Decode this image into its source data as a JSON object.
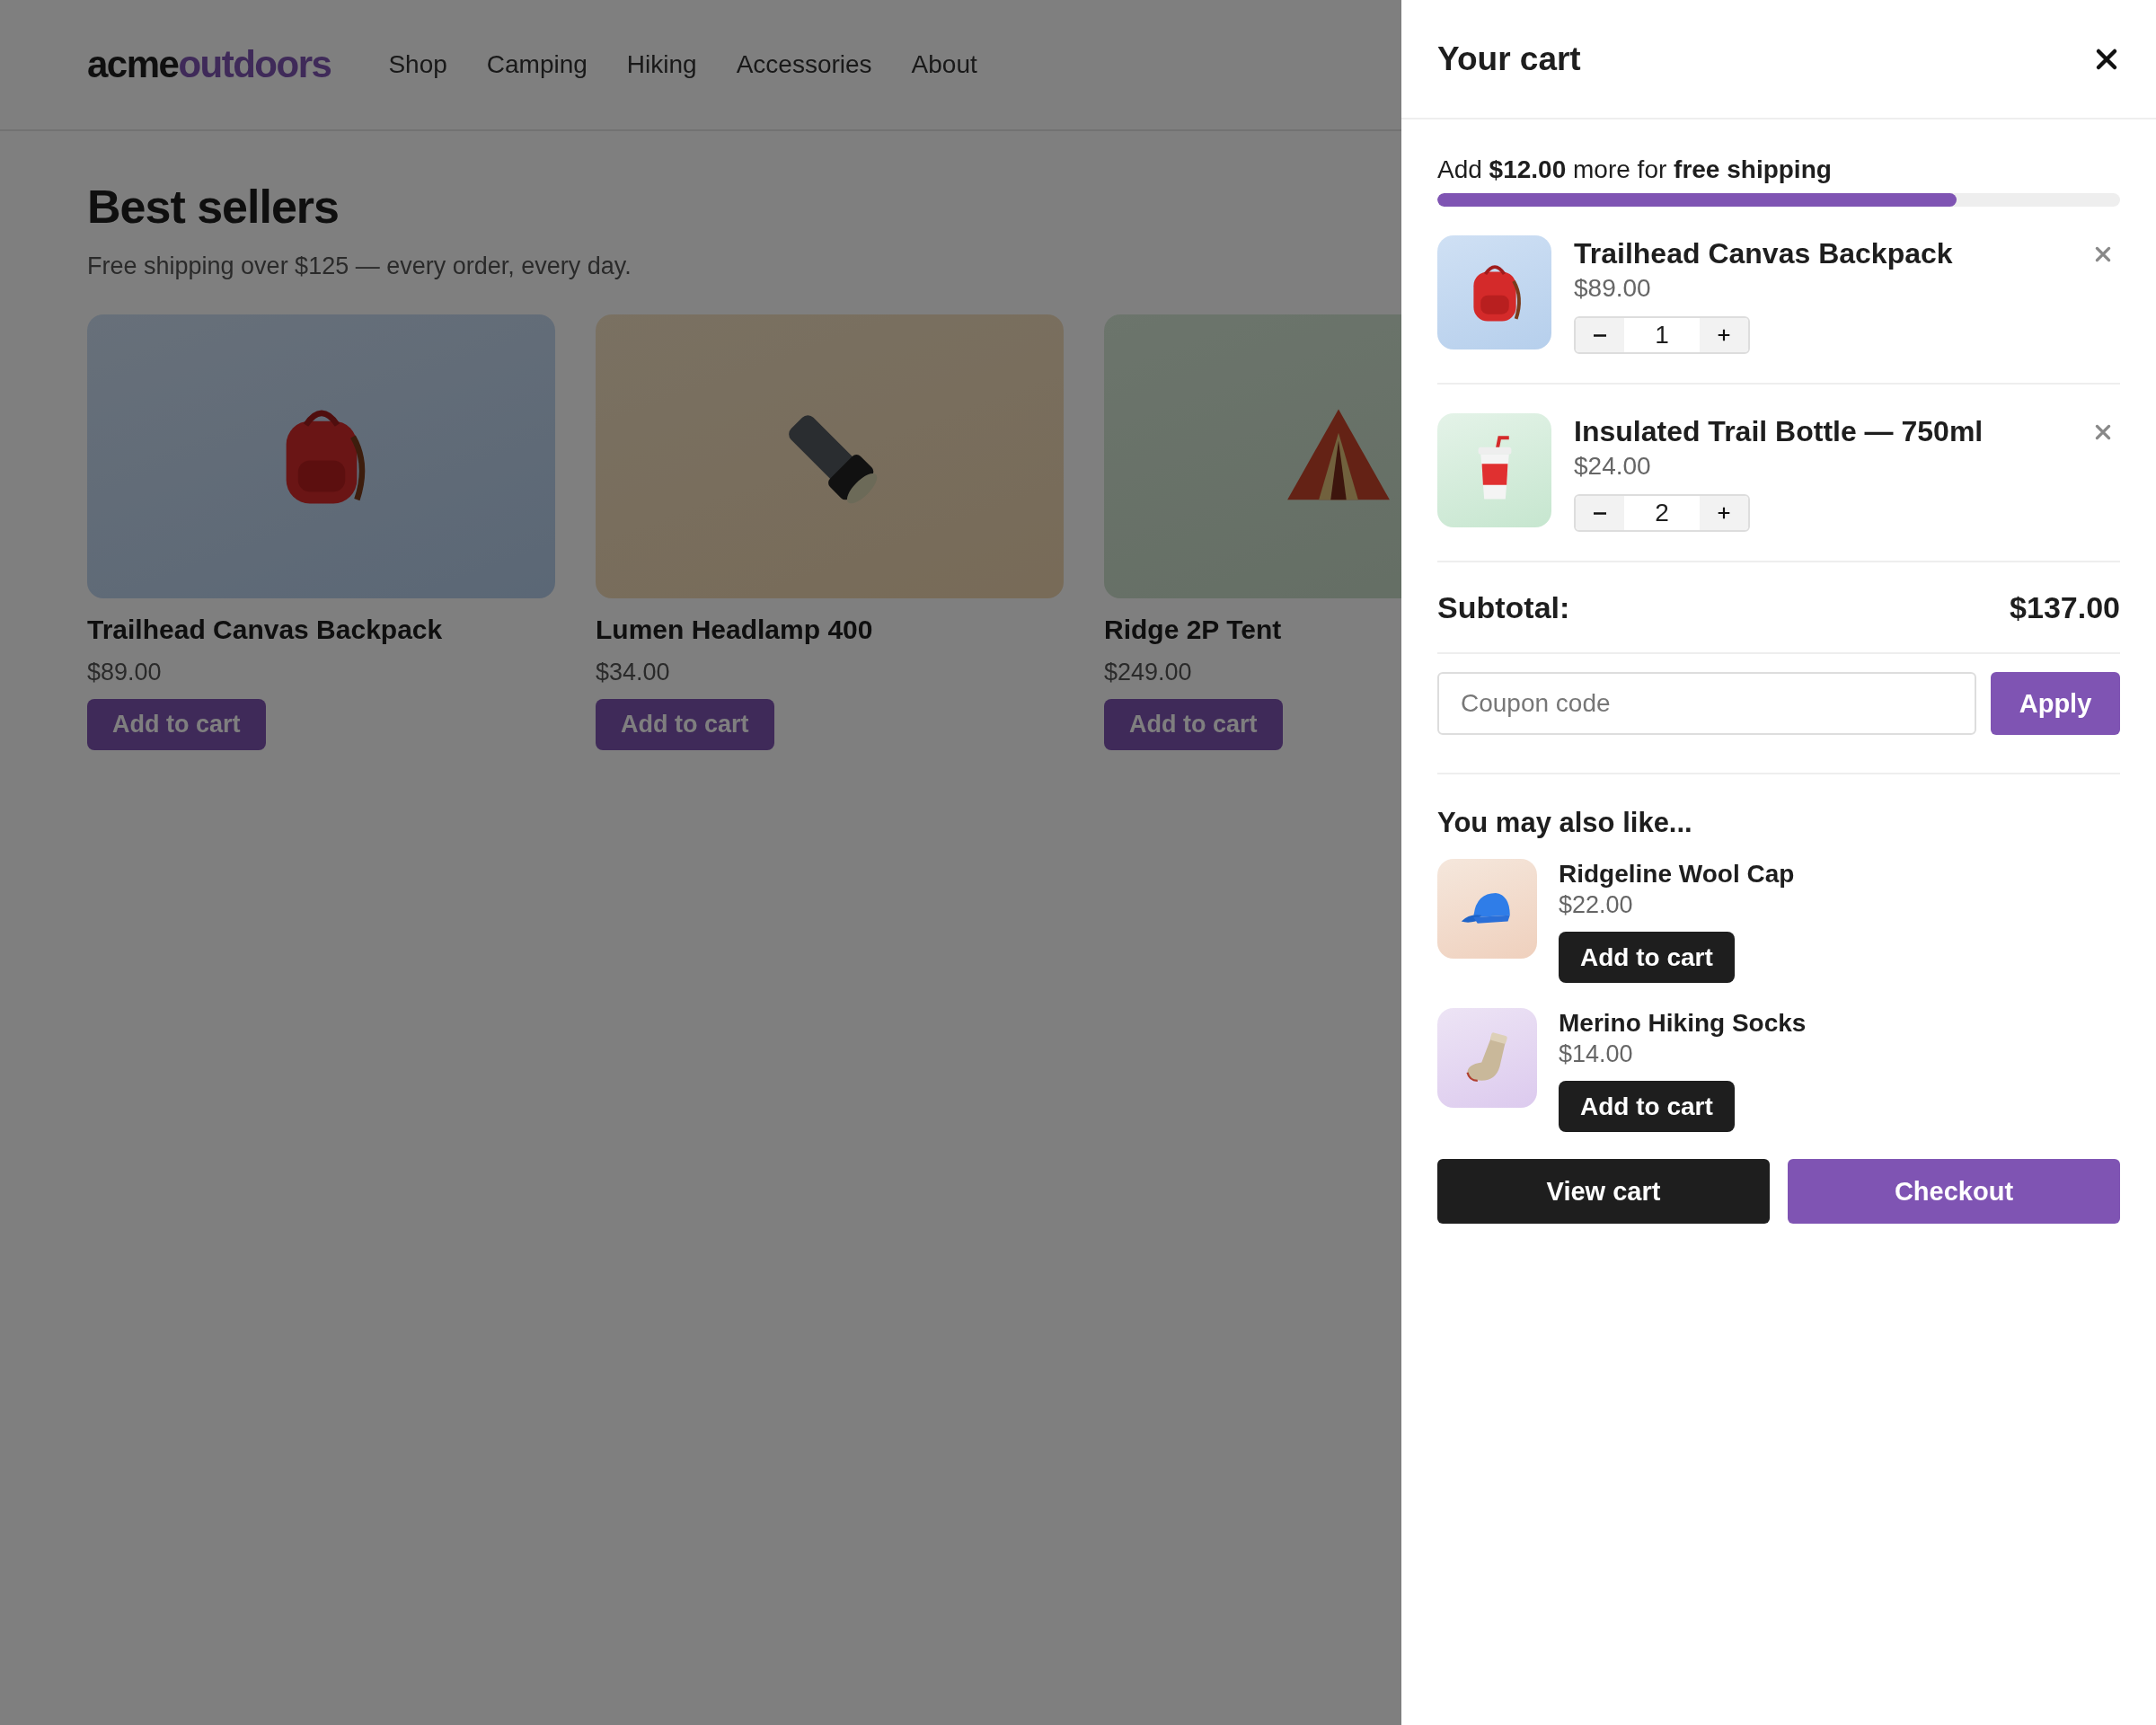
{
  "logo": {
    "primary": "acme",
    "accent": "outdoors"
  },
  "nav": [
    "Shop",
    "Camping",
    "Hiking",
    "Accessories",
    "About"
  ],
  "heading": "Best sellers",
  "subtitle": "Free shipping over $125 — every order, every day.",
  "products": [
    {
      "name": "Trailhead Canvas Backpack",
      "price": "$89.00",
      "button": "Add to cart",
      "kind": "backpack"
    },
    {
      "name": "Lumen Headlamp 400",
      "price": "$34.00",
      "button": "Add to cart",
      "kind": "flashlight"
    },
    {
      "name": "Ridge 2P Tent",
      "price": "$249.00",
      "button": "Add to cart",
      "kind": "tent"
    }
  ],
  "cart": {
    "title": "Your cart",
    "shipping_message": "Add **$12.00** more for **free shipping**",
    "shipping_progress": {
      "level": 0.76
    },
    "items": [
      {
        "name": "Trailhead Canvas Backpack",
        "price": "$89.00",
        "quantity": "1",
        "kind": "backpack"
      },
      {
        "name": "Insulated Trail Bottle — 750ml",
        "price": "$24.00",
        "quantity": "2",
        "kind": "cup"
      }
    ],
    "subtotal_label": "Subtotal:",
    "subtotal": "$137.00",
    "coupon": {
      "placeholder": "Coupon code"
    },
    "apply_button": "Apply",
    "recommendations_title": "You may also like...",
    "recommendations": [
      {
        "name": "Ridgeline Wool Cap",
        "price": "$22.00",
        "button": "Add to cart",
        "kind": "cap"
      },
      {
        "name": "Merino Hiking Socks",
        "price": "$14.00",
        "button": "Add to cart",
        "kind": "sock"
      }
    ],
    "view_cart_button": "View cart",
    "checkout_button": "Checkout"
  }
}
